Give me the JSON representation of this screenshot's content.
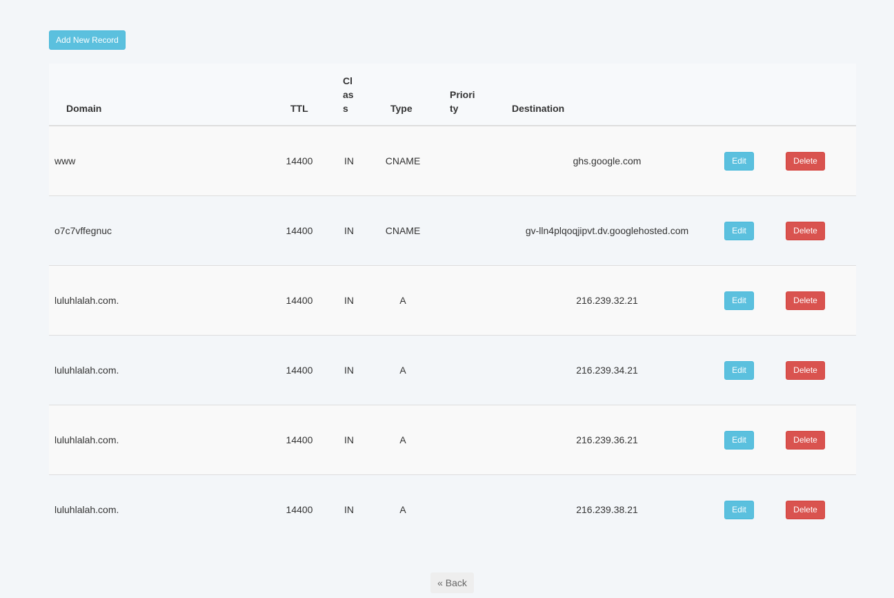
{
  "toolbar": {
    "add_label": "Add New Record"
  },
  "table": {
    "headers": {
      "domain": "Domain",
      "ttl": "TTL",
      "class_lines": [
        "Cl",
        "as",
        "s"
      ],
      "type": "Type",
      "priority_lines": [
        "Priori",
        "ty"
      ],
      "destination": "Destination"
    },
    "rows": [
      {
        "domain": "www",
        "ttl": "14400",
        "class": "IN",
        "type": "CNAME",
        "priority": "",
        "destination": "ghs.google.com",
        "edit": "Edit",
        "delete": "Delete"
      },
      {
        "domain": "o7c7vffegnuc",
        "ttl": "14400",
        "class": "IN",
        "type": "CNAME",
        "priority": "",
        "destination": "gv-lln4plqoqjipvt.dv.googlehosted.com",
        "edit": "Edit",
        "delete": "Delete"
      },
      {
        "domain": "luluhlalah.com.",
        "ttl": "14400",
        "class": "IN",
        "type": "A",
        "priority": "",
        "destination": "216.239.32.21",
        "edit": "Edit",
        "delete": "Delete"
      },
      {
        "domain": "luluhlalah.com.",
        "ttl": "14400",
        "class": "IN",
        "type": "A",
        "priority": "",
        "destination": "216.239.34.21",
        "edit": "Edit",
        "delete": "Delete"
      },
      {
        "domain": "luluhlalah.com.",
        "ttl": "14400",
        "class": "IN",
        "type": "A",
        "priority": "",
        "destination": "216.239.36.21",
        "edit": "Edit",
        "delete": "Delete"
      },
      {
        "domain": "luluhlalah.com.",
        "ttl": "14400",
        "class": "IN",
        "type": "A",
        "priority": "",
        "destination": "216.239.38.21",
        "edit": "Edit",
        "delete": "Delete"
      }
    ]
  },
  "footer": {
    "back_label": "« Back"
  },
  "colors": {
    "info": "#5bc0de",
    "danger": "#d9534f",
    "background": "#f3f6f9"
  }
}
